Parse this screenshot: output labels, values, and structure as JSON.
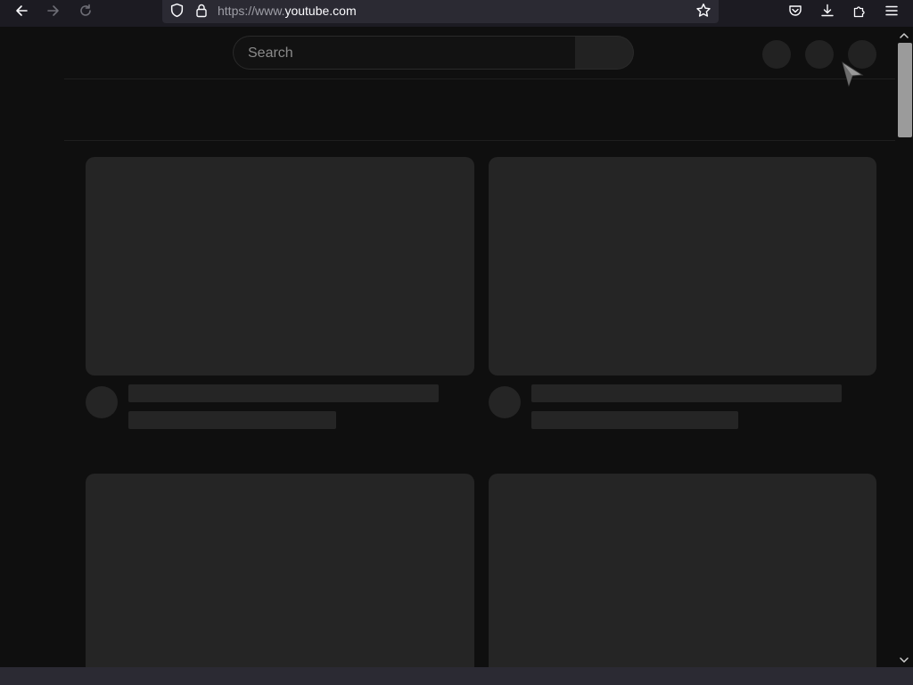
{
  "browser": {
    "url_scheme": "https://www.",
    "url_host": "youtube.com"
  },
  "header": {
    "search_placeholder": "Search"
  },
  "icons": {
    "back": "arrow-left-icon",
    "forward": "arrow-right-icon",
    "reload": "reload-icon",
    "shield": "shield-icon",
    "lock": "lock-icon",
    "bookmark": "star-icon",
    "pocket": "pocket-icon",
    "downloads": "download-icon",
    "extensions": "puzzle-icon",
    "menu": "hamburger-menu-icon"
  },
  "colors": {
    "page_background": "#0f0f0f",
    "skeleton": "#252525",
    "toolbar": "#1c1b22",
    "urlbar": "#2b2a33"
  }
}
